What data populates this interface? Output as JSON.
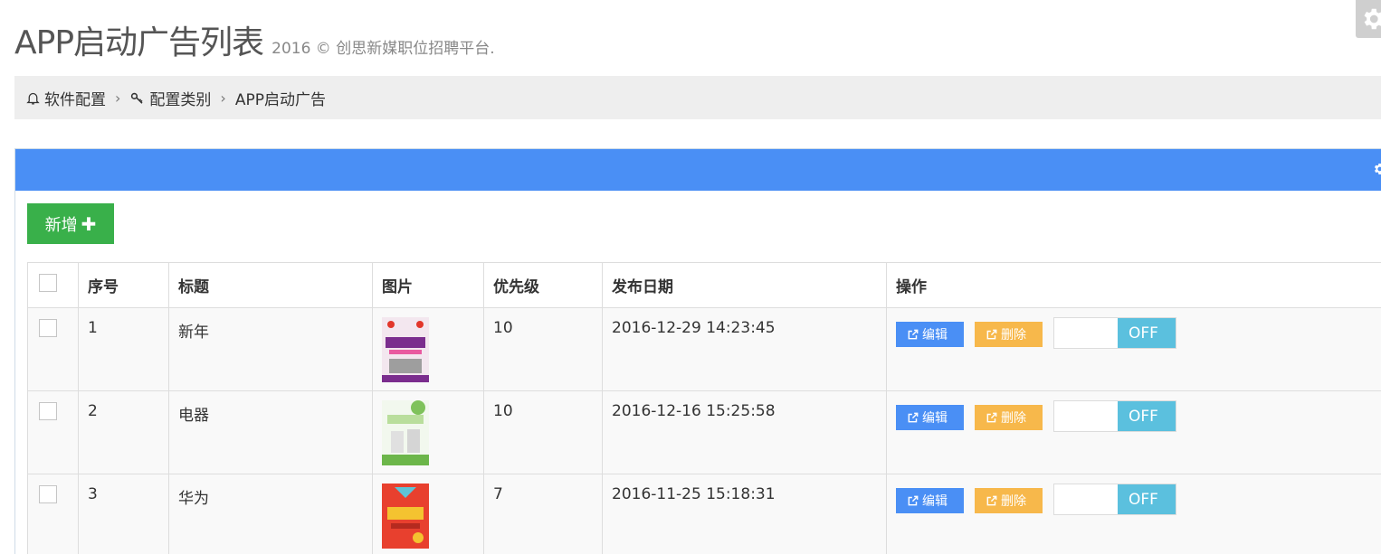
{
  "header": {
    "title": "APP启动广告列表",
    "subtitle": "2016 © 创思新媒职位招聘平台."
  },
  "breadcrumb": {
    "items": [
      {
        "label": "软件配置",
        "icon": "bell-icon"
      },
      {
        "label": "配置类别",
        "icon": "key-icon"
      },
      {
        "label": "APP启动广告",
        "icon": ""
      }
    ]
  },
  "toolbar": {
    "add_label": "新增",
    "add_icon": "plus-icon"
  },
  "table": {
    "columns": [
      "",
      "序号",
      "标题",
      "图片",
      "优先级",
      "发布日期",
      "操作"
    ],
    "rows": [
      {
        "index": "1",
        "title": "新年",
        "image": "new-year-poster",
        "priority": "10",
        "date": "2016-12-29 14:23:45",
        "edit_label": "编辑",
        "delete_label": "删除",
        "toggle_label": "OFF"
      },
      {
        "index": "2",
        "title": "电器",
        "image": "appliance-poster",
        "priority": "10",
        "date": "2016-12-16 15:25:58",
        "edit_label": "编辑",
        "delete_label": "删除",
        "toggle_label": "OFF"
      },
      {
        "index": "3",
        "title": "华为",
        "image": "huawei-poster",
        "priority": "7",
        "date": "2016-11-25 15:18:31",
        "edit_label": "编辑",
        "delete_label": "删除",
        "toggle_label": "OFF"
      }
    ]
  },
  "colors": {
    "panel_heading": "#4a8ff5",
    "add_button": "#39b04a",
    "edit_button": "#4a8ff5",
    "delete_button": "#f7b84b",
    "toggle_off": "#5bc0de"
  }
}
